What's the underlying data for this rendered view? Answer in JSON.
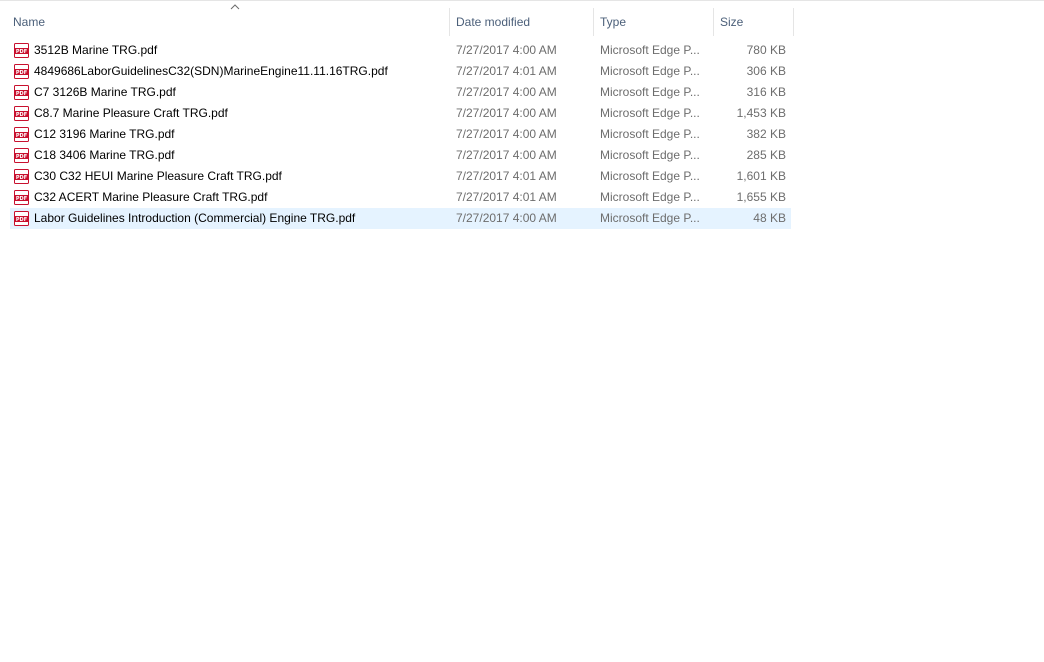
{
  "columns": {
    "name": "Name",
    "date": "Date modified",
    "type": "Type",
    "size": "Size"
  },
  "sort": {
    "column": "name",
    "icon": "chevron-up-icon"
  },
  "file_icon": "pdf-file-icon",
  "files": [
    {
      "name": "3512B Marine TRG.pdf",
      "date": "7/27/2017 4:00 AM",
      "type": "Microsoft Edge P...",
      "size": "780 KB"
    },
    {
      "name": "4849686LaborGuidelinesC32(SDN)MarineEngine11.11.16TRG.pdf",
      "date": "7/27/2017 4:01 AM",
      "type": "Microsoft Edge P...",
      "size": "306 KB"
    },
    {
      "name": "C7 3126B Marine TRG.pdf",
      "date": "7/27/2017 4:00 AM",
      "type": "Microsoft Edge P...",
      "size": "316 KB"
    },
    {
      "name": "C8.7 Marine Pleasure Craft TRG.pdf",
      "date": "7/27/2017 4:00 AM",
      "type": "Microsoft Edge P...",
      "size": "1,453 KB"
    },
    {
      "name": "C12 3196 Marine TRG.pdf",
      "date": "7/27/2017 4:00 AM",
      "type": "Microsoft Edge P...",
      "size": "382 KB"
    },
    {
      "name": "C18 3406 Marine TRG.pdf",
      "date": "7/27/2017 4:00 AM",
      "type": "Microsoft Edge P...",
      "size": "285 KB"
    },
    {
      "name": "C30 C32 HEUI Marine Pleasure Craft TRG.pdf",
      "date": "7/27/2017 4:01 AM",
      "type": "Microsoft Edge P...",
      "size": "1,601 KB"
    },
    {
      "name": "C32 ACERT Marine Pleasure Craft TRG.pdf",
      "date": "7/27/2017 4:01 AM",
      "type": "Microsoft Edge P...",
      "size": "1,655 KB"
    },
    {
      "name": "Labor Guidelines Introduction (Commercial) Engine TRG.pdf",
      "date": "7/27/2017 4:00 AM",
      "type": "Microsoft Edge P...",
      "size": "48 KB",
      "selected": true
    }
  ],
  "colors": {
    "header_text": "#4c607a",
    "detail_text": "#6d6d6d",
    "selection": "#e5f3ff",
    "pdf_red": "#c8102e"
  }
}
